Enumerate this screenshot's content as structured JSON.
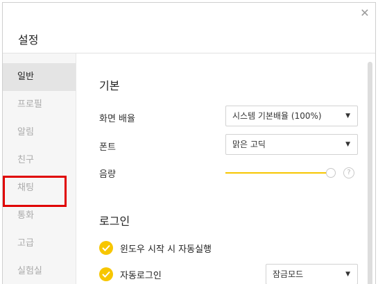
{
  "window": {
    "title": "설정",
    "close_glyph": "✕"
  },
  "sidebar": {
    "items": [
      {
        "label": "일반",
        "active": true
      },
      {
        "label": "프로필",
        "active": false
      },
      {
        "label": "알림",
        "active": false
      },
      {
        "label": "친구",
        "active": false
      },
      {
        "label": "채팅",
        "active": false
      },
      {
        "label": "통화",
        "active": false
      },
      {
        "label": "고급",
        "active": false
      },
      {
        "label": "실험실",
        "active": false
      }
    ],
    "highlighted_item": "채팅",
    "highlight_color": "#e00000"
  },
  "basic": {
    "title": "기본",
    "zoom": {
      "label": "화면 배율",
      "value": "시스템 기본배율 (100%)"
    },
    "font": {
      "label": "폰트",
      "value": "맑은 고딕"
    },
    "volume": {
      "label": "음량",
      "level": 1.0,
      "help_glyph": "?"
    }
  },
  "login": {
    "title": "로그인",
    "autostart": {
      "label": "윈도우 시작 시 자동실행",
      "checked": true
    },
    "autologin": {
      "label": "자동로그인",
      "checked": true
    },
    "lock_mode": {
      "value": "잠금모드"
    }
  },
  "colors": {
    "accent": "#f7c600",
    "sidebar_bg": "#f6f6f6",
    "active_item_bg": "#e4e4e4"
  }
}
